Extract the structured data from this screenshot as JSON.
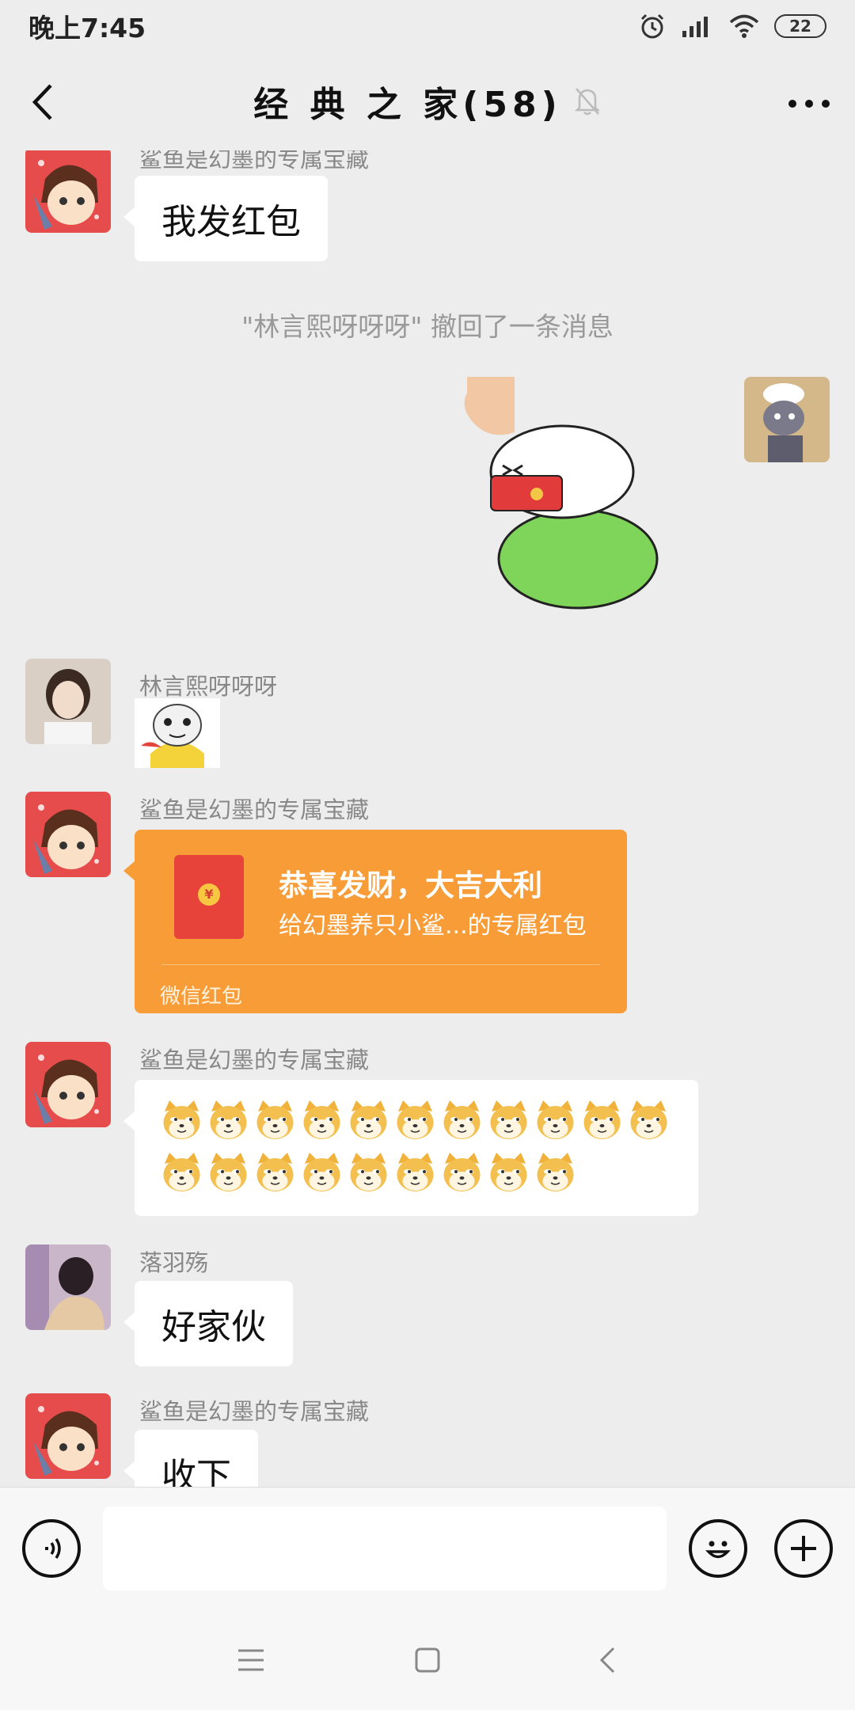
{
  "status_bar": {
    "time": "晚上7:45",
    "battery": "22"
  },
  "header": {
    "title": "经 典 之 家(58)"
  },
  "messages": [
    {
      "sender": "鲨鱼是幻墨的专属宝藏",
      "text": "我发红包"
    },
    {
      "system": "\"林言熙呀呀呀\" 撤回了一条消息"
    },
    {
      "sender": "林言熙呀呀呀"
    },
    {
      "sender": "鲨鱼是幻墨的专属宝藏",
      "red_packet": {
        "title": "恭喜发财，大吉大利",
        "subtitle": "给幻墨养只小鲨...的专属红包",
        "footer": "微信红包",
        "coin": "¥"
      }
    },
    {
      "sender": "鲨鱼是幻墨的专属宝藏",
      "emoji_rows": [
        11,
        9
      ]
    },
    {
      "sender": "落羽殇",
      "text": "好家伙"
    },
    {
      "sender": "鲨鱼是幻墨的专属宝藏",
      "text": "收下"
    }
  ],
  "input": {
    "placeholder": ""
  },
  "icons": {
    "back": "chevron-left-icon",
    "mute": "bell-off-icon",
    "more": "more-horizontal-icon",
    "voice": "voice-icon",
    "emoji": "smiley-icon",
    "plus": "plus-icon",
    "nav_menu": "menu-icon",
    "nav_home": "home-square-icon",
    "nav_back": "back-icon"
  },
  "colors": {
    "background": "#ededed",
    "red_packet": "#f89c38",
    "bubble": "#ffffff"
  }
}
